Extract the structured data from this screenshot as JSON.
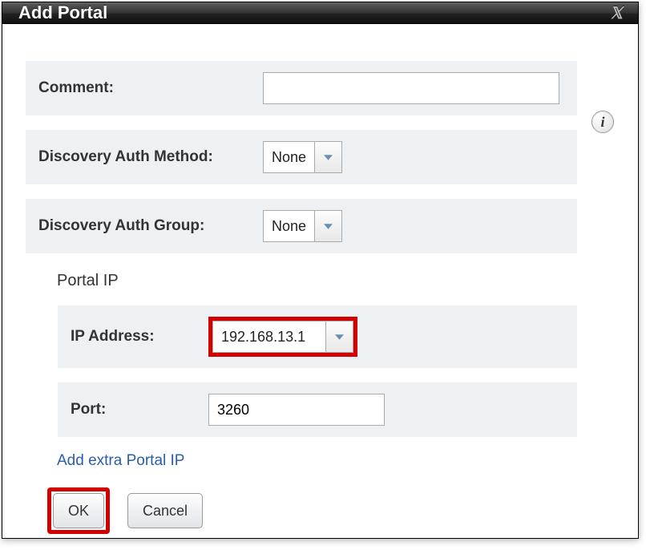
{
  "dialog": {
    "title": "Add Portal",
    "close_glyph": "✕"
  },
  "fields": {
    "comment": {
      "label": "Comment:",
      "value": ""
    },
    "auth_method": {
      "label": "Discovery Auth Method:",
      "value": "None"
    },
    "auth_group": {
      "label": "Discovery Auth Group:",
      "value": "None"
    },
    "portal_ip_section": "Portal IP",
    "ip_address": {
      "label": "IP Address:",
      "value": "192.168.13.1"
    },
    "port": {
      "label": "Port:",
      "value": "3260"
    }
  },
  "links": {
    "add_extra": "Add extra Portal IP"
  },
  "buttons": {
    "ok": "OK",
    "cancel": "Cancel"
  },
  "info_icon": "i"
}
